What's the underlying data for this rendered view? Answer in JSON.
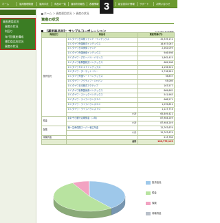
{
  "header": {
    "nav": [
      "ホーム",
      "運用管理制度",
      "運用手法",
      "商品の一覧",
      "運用状況報告",
      "各種情報",
      "組合員向け情報",
      "サポート",
      "お問い合わせ"
    ],
    "badge": "3"
  },
  "breadcrumb": "ホーム ＞ 資産運用状況 ＞ 資産の状況",
  "sidebar": {
    "items": [
      {
        "label": "資産運用状況",
        "sub": false
      },
      {
        "label": "資産の状況",
        "sub": true
      },
      {
        "label": "利回り",
        "sub": true
      },
      {
        "label": "年代別資産構成",
        "sub": true
      },
      {
        "label": "運用商品別状況",
        "sub": true
      },
      {
        "label": "資産の状況",
        "sub": true
      }
    ]
  },
  "main": {
    "title": "資産の状況",
    "fund_name": "【運用商品別】：サンプルコーポレーション",
    "as_of": "2019年9月末現在",
    "columns": [
      "商品区分",
      "商品名",
      "資産残高(円)"
    ],
    "groups": [
      {
        "category": "投資信託",
        "rows": [
          {
            "name": "ＤＣダイワ日本株ファンド・インデックス",
            "amount": "32,349,172"
          },
          {
            "name": "ＤＣダイワ外国株式インデックス",
            "amount": "16,957,067"
          },
          {
            "name": "ＤＣダイワ日本債券ファンド",
            "amount": "2,462,059"
          },
          {
            "name": "ＤＣダイワ外国債券インデックス",
            "amount": "946,998"
          },
          {
            "name": "ＤＣダイワ・グローバル・バランス",
            "amount": "1,862,415"
          },
          {
            "name": "ＤＣダイワ新興国株式インデックス",
            "amount": "689,268"
          },
          {
            "name": "ＤＣダイワＲＥＩＴインデックス",
            "amount": "4,156,501"
          },
          {
            "name": "ＤＣダイワ・ターゲットイヤー",
            "amount": "2,736,561"
          },
          {
            "name": "ＤＣダイワ外国リートインデックス",
            "amount": "78,837"
          },
          {
            "name": "ＤＣダイワ・アクティブ・ジャパン",
            "amount": "93,069"
          },
          {
            "name": "ＤＣダイワ日本株式アクティブ",
            "amount": "167,577"
          },
          {
            "name": "ＤＣダイワ新興国債券インデックス",
            "amount": "869,862"
          },
          {
            "name": "ＤＣダイワ・ストックインデックス",
            "amount": "541,963"
          },
          {
            "name": "ＤＣダイワ・ライフバランス３０",
            "amount": "668,571"
          },
          {
            "name": "ＤＣダイワ・ライフバランス５０",
            "amount": "1,099,851"
          },
          {
            "name": "ＤＣダイワ・ライフバランス７０",
            "amount": "1,127,774"
          }
        ],
        "subtotal_label": "小計",
        "subtotal": "65,809,421"
      },
      {
        "category": "預金",
        "rows": [
          {
            "name": "あおぞら銀行定期預金（１年）",
            "amount": "87,984,249"
          }
        ],
        "subtotal_label": "小計",
        "subtotal": "87,984,249"
      },
      {
        "category": "保険",
        "rows": [
          {
            "name": "第一生命保険スーパー積立年金",
            "amount": "12,767,679"
          }
        ],
        "subtotal_label": "小計",
        "subtotal": "12,767,679"
      },
      {
        "category": "待機資金",
        "rows": [
          {
            "name": "",
            "amount": "213,764"
          }
        ],
        "subtotal_label": "",
        "subtotal": ""
      }
    ],
    "total_label": "合計",
    "total": "166,775,113"
  },
  "chart_data": {
    "type": "pie",
    "style": "3d",
    "labels": [
      "投資信託",
      "預金",
      "保険",
      "待機資金"
    ],
    "values": [
      65809421,
      87984249,
      12767679,
      213764
    ],
    "colors": [
      "#9ec8ea",
      "#b8e3a0",
      "#f2a3c2",
      "#b8bfc9"
    ],
    "legend_position": "right"
  }
}
